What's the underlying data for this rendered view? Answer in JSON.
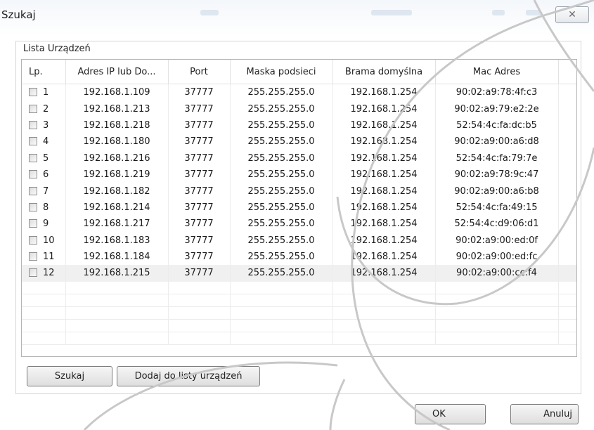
{
  "window": {
    "title": "Szukaj",
    "close_glyph": "✕"
  },
  "group": {
    "label": "Lista Urządzeń"
  },
  "table": {
    "columns": [
      "Lp.",
      "Adres IP lub Do...",
      "Port",
      "Maska podsieci",
      "Brama domyślna",
      "Mac Adres"
    ],
    "rows": [
      {
        "lp": "1",
        "ip": "192.168.1.109",
        "port": "37777",
        "mask": "255.255.255.0",
        "gateway": "192.168.1.254",
        "mac": "90:02:a9:78:4f:c3"
      },
      {
        "lp": "2",
        "ip": "192.168.1.213",
        "port": "37777",
        "mask": "255.255.255.0",
        "gateway": "192.168.1.254",
        "mac": "90:02:a9:79:e2:2e"
      },
      {
        "lp": "3",
        "ip": "192.168.1.218",
        "port": "37777",
        "mask": "255.255.255.0",
        "gateway": "192.168.1.254",
        "mac": "52:54:4c:fa:dc:b5"
      },
      {
        "lp": "4",
        "ip": "192.168.1.180",
        "port": "37777",
        "mask": "255.255.255.0",
        "gateway": "192.168.1.254",
        "mac": "90:02:a9:00:a6:d8"
      },
      {
        "lp": "5",
        "ip": "192.168.1.216",
        "port": "37777",
        "mask": "255.255.255.0",
        "gateway": "192.168.1.254",
        "mac": "52:54:4c:fa:79:7e"
      },
      {
        "lp": "6",
        "ip": "192.168.1.219",
        "port": "37777",
        "mask": "255.255.255.0",
        "gateway": "192.168.1.254",
        "mac": "90:02:a9:78:9c:47"
      },
      {
        "lp": "7",
        "ip": "192.168.1.182",
        "port": "37777",
        "mask": "255.255.255.0",
        "gateway": "192.168.1.254",
        "mac": "90:02:a9:00:a6:b8"
      },
      {
        "lp": "8",
        "ip": "192.168.1.214",
        "port": "37777",
        "mask": "255.255.255.0",
        "gateway": "192.168.1.254",
        "mac": "52:54:4c:fa:49:15"
      },
      {
        "lp": "9",
        "ip": "192.168.1.217",
        "port": "37777",
        "mask": "255.255.255.0",
        "gateway": "192.168.1.254",
        "mac": "52:54:4c:d9:06:d1"
      },
      {
        "lp": "10",
        "ip": "192.168.1.183",
        "port": "37777",
        "mask": "255.255.255.0",
        "gateway": "192.168.1.254",
        "mac": "90:02:a9:00:ed:0f"
      },
      {
        "lp": "11",
        "ip": "192.168.1.184",
        "port": "37777",
        "mask": "255.255.255.0",
        "gateway": "192.168.1.254",
        "mac": "90:02:a9:00:ed:fc"
      },
      {
        "lp": "12",
        "ip": "192.168.1.215",
        "port": "37777",
        "mask": "255.255.255.0",
        "gateway": "192.168.1.254",
        "mac": "90:02:a9:00:cc:f4"
      }
    ],
    "selected_row": "12"
  },
  "buttons": {
    "search": "Szukaj",
    "add_to_list": "Dodaj do listy urządzeń",
    "ok": "OK",
    "cancel": "Anuluj"
  },
  "colors": {
    "frame_border": "#d5d5d5",
    "grid_border": "#b5b5b5",
    "selected_row_bg": "#f0f0f0"
  }
}
